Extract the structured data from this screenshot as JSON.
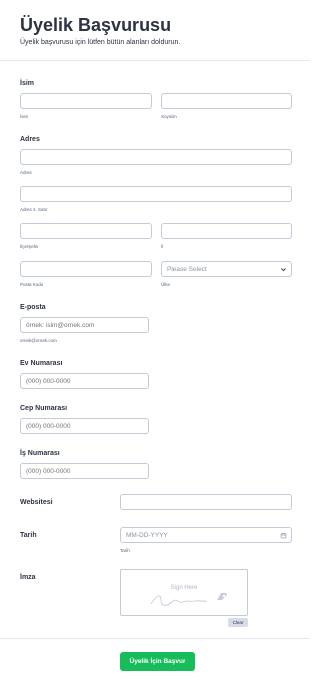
{
  "form": {
    "title": "Üyelik Başvurusu",
    "subtitle": "Üyelik başvurusu için lütfen bütün alanları doldurun."
  },
  "name": {
    "label": "İsim",
    "first_sub": "İsim",
    "last_sub": "Soyisim"
  },
  "address": {
    "label": "Adres",
    "line1_sub": "Adres",
    "line2_sub": "Adres 2. Satır",
    "city_sub": "İlçe/Şehir",
    "state_sub": "İl",
    "zip_sub": "Posta Kodu",
    "country_sub": "Ülke",
    "country_value": "Please Select"
  },
  "email": {
    "label": "E-posta",
    "placeholder": "örnek: isim@ornek.com",
    "sub": "ornek@ornek.com"
  },
  "home_phone": {
    "label": "Ev Numarası",
    "placeholder": "(000) 000-0000"
  },
  "mobile_phone": {
    "label": "Cep Numarası",
    "placeholder": "(000) 000-0000"
  },
  "work_phone": {
    "label": "İş Numarası",
    "placeholder": "(000) 000-0000"
  },
  "website": {
    "label": "Websitesi"
  },
  "date": {
    "label": "Tarih",
    "placeholder": "MM-DD-YYYY",
    "sub": "Tarih"
  },
  "signature": {
    "label": "İmza",
    "hint": "Sign Here",
    "clear_label": "Clear"
  },
  "submit": {
    "label": "Üyelik İçin Başvur",
    "color": "#18bd5b"
  }
}
